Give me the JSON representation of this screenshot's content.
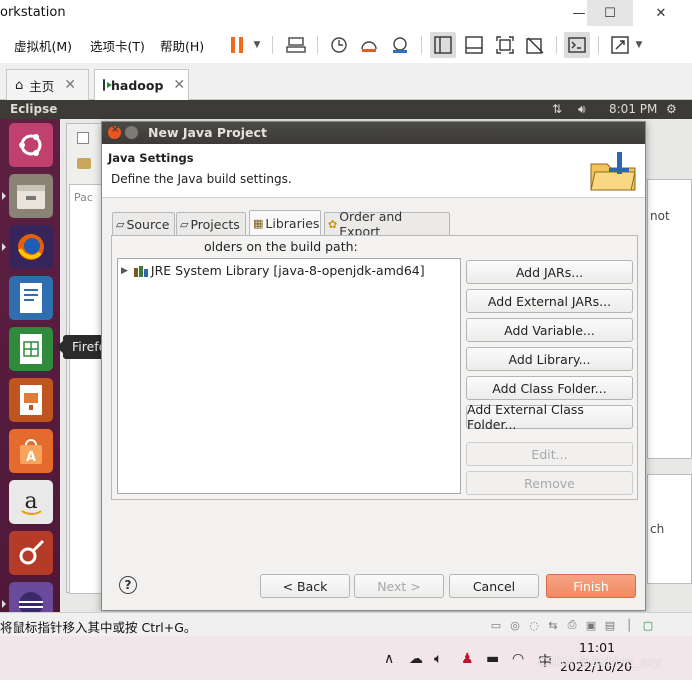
{
  "vmware": {
    "title": "orkstation",
    "menus": [
      "虚拟机(M)",
      "选项卡(T)",
      "帮助(H)"
    ],
    "tabs": [
      {
        "label": "主页",
        "icon": "home-icon"
      },
      {
        "label": "hadoop",
        "icon": "vm-icon"
      }
    ],
    "status_message": "将鼠标指针移入其中或按 Ctrl+G。"
  },
  "ubuntu": {
    "top_app": "Eclipse",
    "time": "8:01 PM",
    "tooltip": "Firefox Web Browser"
  },
  "dialog": {
    "title": "New Java Project",
    "heading": "Java Settings",
    "subheading": "Define the Java build settings.",
    "tabs": [
      "Source",
      "Projects",
      "Libraries",
      "Order and Export"
    ],
    "active_tab": "Libraries",
    "body_label": "olders on the build path:",
    "tree_item": "JRE System Library [java-8-openjdk-amd64]",
    "side_buttons": {
      "add_jars": "Add JARs...",
      "add_external_jars": "Add External JARs...",
      "add_variable": "Add Variable...",
      "add_library": "Add Library...",
      "add_class_folder": "Add Class Folder...",
      "add_external_class_folder": "Add External Class Folder...",
      "edit": "Edit...",
      "remove": "Remove"
    },
    "footer": {
      "back": "< Back",
      "next": "Next >",
      "cancel": "Cancel",
      "finish": "Finish",
      "help": "?"
    }
  },
  "eclipse_bg": {
    "pane_fragments": [
      "Pac",
      "not",
      "ch"
    ]
  },
  "taskbar": {
    "time": "11:01",
    "date": "2022/10/20",
    "watermark": "CSDN @Bubble_asy"
  },
  "colors": {
    "finish_button": "#f08a62",
    "launcher": "#5d2043",
    "title_bar": "#3c3b37"
  }
}
